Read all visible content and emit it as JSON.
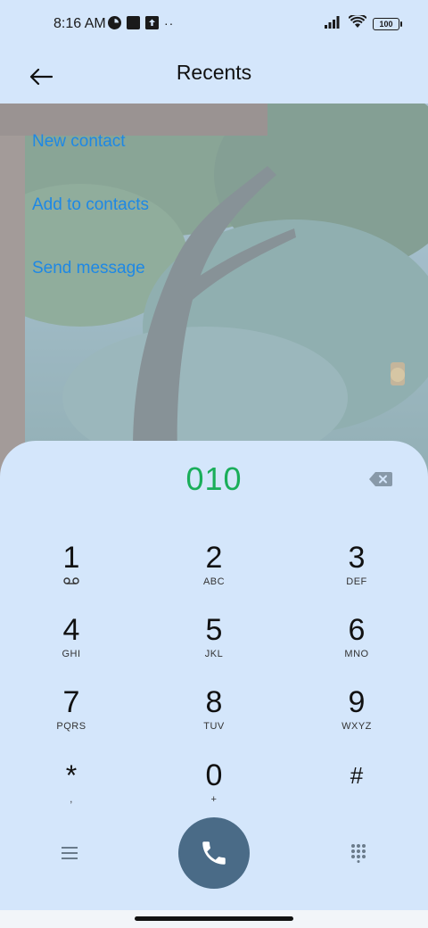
{
  "status_bar": {
    "time": "8:16 AM",
    "left_icons": [
      "record-icon",
      "notification-square-icon",
      "upload-icon",
      "more-dots-icon"
    ],
    "more_dots": "··",
    "right_icons": [
      "signal-icon",
      "wifi-icon",
      "battery-icon"
    ],
    "battery_level": "100"
  },
  "app_bar": {
    "back_icon": "arrow-left-icon",
    "title": "Recents"
  },
  "actions": [
    {
      "label": "New contact"
    },
    {
      "label": "Add to contacts"
    },
    {
      "label": "Send message"
    }
  ],
  "dialer": {
    "number": "010",
    "backspace_icon": "backspace-icon",
    "keys": [
      {
        "digit": "1",
        "letters": "",
        "sub_icon": "voicemail-icon"
      },
      {
        "digit": "2",
        "letters": "ABC"
      },
      {
        "digit": "3",
        "letters": "DEF"
      },
      {
        "digit": "4",
        "letters": "GHI"
      },
      {
        "digit": "5",
        "letters": "JKL"
      },
      {
        "digit": "6",
        "letters": "MNO"
      },
      {
        "digit": "7",
        "letters": "PQRS"
      },
      {
        "digit": "8",
        "letters": "TUV"
      },
      {
        "digit": "9",
        "letters": "WXYZ"
      },
      {
        "digit": "*",
        "letters": ","
      },
      {
        "digit": "0",
        "letters": "+"
      },
      {
        "digit": "#",
        "letters": ""
      }
    ],
    "bottom": {
      "menu_icon": "hamburger-menu-icon",
      "call_icon": "phone-icon",
      "keypad_icon": "dialpad-icon"
    }
  },
  "colors": {
    "background": "#d4e6fb",
    "number": "#1aae5a",
    "link": "#1e88e5",
    "call_button": "#4a6b87"
  }
}
